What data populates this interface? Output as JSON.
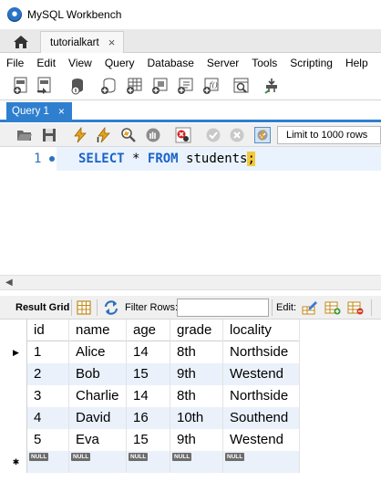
{
  "window": {
    "title": "MySQL Workbench"
  },
  "connection_tab": {
    "label": "tutorialkart",
    "close": "×"
  },
  "menu": [
    "File",
    "Edit",
    "View",
    "Query",
    "Database",
    "Server",
    "Tools",
    "Scripting",
    "Help"
  ],
  "query_tab": {
    "label": "Query 1",
    "close": "×"
  },
  "editor": {
    "line_number": "1",
    "tokens": {
      "select": "SELECT",
      "star": "*",
      "from": "FROM",
      "table": "students",
      "semicolon": ";"
    }
  },
  "limit": {
    "selected": "Limit to 1000 rows"
  },
  "results": {
    "grid_label": "Result Grid",
    "filter_label": "Filter Rows:",
    "filter_value": "",
    "edit_label": "Edit:",
    "columns": [
      "id",
      "name",
      "age",
      "grade",
      "locality"
    ],
    "rows": [
      [
        "1",
        "Alice",
        "14",
        "8th",
        "Northside"
      ],
      [
        "2",
        "Bob",
        "15",
        "9th",
        "Westend"
      ],
      [
        "3",
        "Charlie",
        "14",
        "8th",
        "Northside"
      ],
      [
        "4",
        "David",
        "16",
        "10th",
        "Southend"
      ],
      [
        "5",
        "Eva",
        "15",
        "9th",
        "Westend"
      ]
    ],
    "null_label": "NULL",
    "current_row_marker": "▶",
    "new_row_marker": "✱"
  },
  "colors": {
    "accent": "#2f7fcf",
    "keyword": "#1b63c9",
    "row_alt": "#eaf1fb"
  },
  "icons": {
    "home": "home-icon",
    "toolbar": [
      "new-sql-tab-icon",
      "open-sql-script-icon",
      "schema-inspector-icon",
      "create-schema-icon",
      "create-table-icon",
      "create-view-icon",
      "create-procedure-icon",
      "create-function-icon",
      "search-table-data-icon",
      "reconnect-icon"
    ],
    "editor_toolbar": [
      "open-file-icon",
      "save-icon",
      "execute-icon",
      "execute-current-icon",
      "explain-icon",
      "stop-icon",
      "toggle-error-icon",
      "commit-icon",
      "rollback-icon",
      "autocommit-icon"
    ]
  }
}
